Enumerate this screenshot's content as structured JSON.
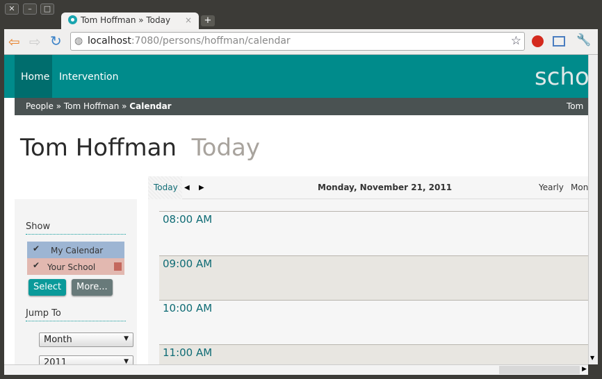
{
  "browser": {
    "tab_title": "Tom Hoffman » Today",
    "url_host": "localhost",
    "url_rest": ":7080/persons/hoffman/calendar"
  },
  "nav": {
    "items": [
      "Home",
      "Intervention"
    ],
    "brand": "schoo"
  },
  "breadcrumb": {
    "items": [
      "People",
      "Tom Hoffman",
      "Calendar"
    ],
    "sep": "»",
    "user": "Tom H"
  },
  "page": {
    "title": "Tom Hoffman",
    "subtitle": "Today"
  },
  "calendar": {
    "today": "Today",
    "date": "Monday, November 21, 2011",
    "views": [
      "Yearly",
      "Mon"
    ],
    "hours": [
      "08:00 AM",
      "09:00 AM",
      "10:00 AM",
      "11:00 AM"
    ]
  },
  "sidebar": {
    "show_heading": "Show",
    "calendars": [
      {
        "label": "My Calendar",
        "checked": true,
        "color": "#9db5d3"
      },
      {
        "label": "Your School",
        "checked": true,
        "color": "#e2b8b0"
      }
    ],
    "select_label": "Select",
    "more_label": "More...",
    "jump_heading": "Jump To",
    "month_value": "Month",
    "year_value": "2011"
  }
}
